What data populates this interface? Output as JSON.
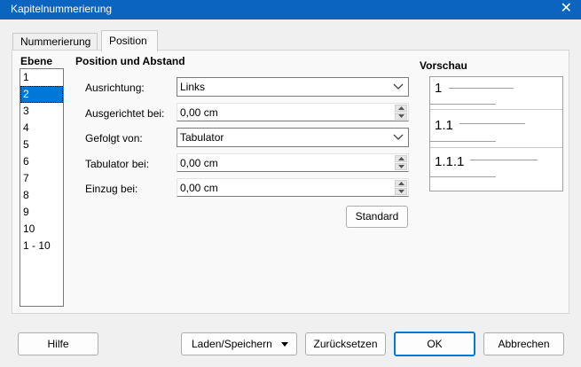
{
  "window": {
    "title": "Kapitelnummerierung",
    "close_icon": "close-icon"
  },
  "tabs": [
    {
      "label": "Nummerierung",
      "active": false
    },
    {
      "label": "Position",
      "active": true
    }
  ],
  "levels": {
    "heading": "Ebene",
    "items": [
      "1",
      "2",
      "3",
      "4",
      "5",
      "6",
      "7",
      "8",
      "9",
      "10",
      "1 - 10"
    ],
    "selected": "2"
  },
  "position": {
    "heading": "Position und Abstand",
    "alignment": {
      "label": "Ausrichtung:",
      "value": "Links"
    },
    "aligned_at": {
      "label": "Ausgerichtet bei:",
      "value": "0,00 cm"
    },
    "followed_by": {
      "label": "Gefolgt von:",
      "value": "Tabulator"
    },
    "tab_at": {
      "label": "Tabulator bei:",
      "value": "0,00 cm"
    },
    "indent_at": {
      "label": "Einzug bei:",
      "value": "0,00 cm"
    },
    "default_button": "Standard"
  },
  "preview": {
    "heading": "Vorschau",
    "levels": [
      "1",
      "1.1",
      "1.1.1"
    ]
  },
  "buttons": {
    "help": "Hilfe",
    "load_save": "Laden/Speichern",
    "reset": "Zurücksetzen",
    "ok": "OK",
    "cancel": "Abbrechen"
  },
  "colors": {
    "titlebar": "#0a64c0",
    "selection": "#0078d7",
    "ok_border": "#0078d7"
  }
}
